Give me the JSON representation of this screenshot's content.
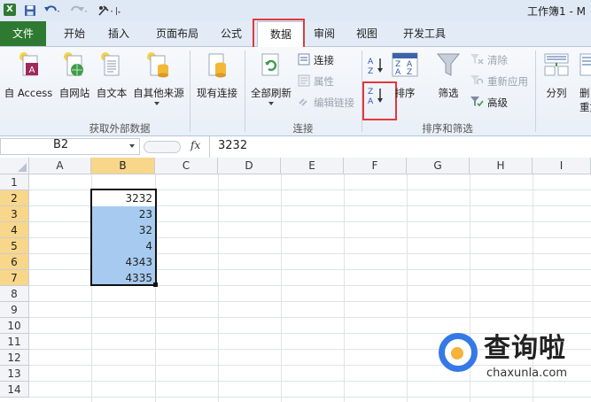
{
  "window": {
    "title": "工作簿1 - M"
  },
  "quick_access": {
    "save_icon": "save-icon",
    "undo_icon": "undo-icon",
    "redo_icon": "redo-icon",
    "custom_icon": "customize-icon"
  },
  "tabs": [
    "文件",
    "开始",
    "插入",
    "页面布局",
    "公式",
    "数据",
    "审阅",
    "视图",
    "开发工具"
  ],
  "active_tab": "数据",
  "ribbon": {
    "get_external": {
      "buttons": [
        "自 Access",
        "自网站",
        "自文本",
        "自其他来源",
        "现有连接"
      ],
      "label": "获取外部数据"
    },
    "connections": {
      "refresh_all": "全部刷新",
      "items": [
        "连接",
        "属性",
        "编辑链接"
      ],
      "label": "连接"
    },
    "sort_filter": {
      "sort": "排序",
      "filter": "筛选",
      "items": [
        "清除",
        "重新应用",
        "高级"
      ],
      "label": "排序和筛选"
    },
    "data_tools": {
      "split": "分列",
      "delete_partial": "删",
      "dup_partial": "重复"
    }
  },
  "formula_bar": {
    "name_box": "B2",
    "fx": "fx",
    "value": "3232"
  },
  "columns": [
    "A",
    "B",
    "C",
    "D",
    "E",
    "F",
    "G",
    "H",
    "I"
  ],
  "rows": [
    "1",
    "2",
    "3",
    "4",
    "5",
    "6",
    "7",
    "8",
    "9",
    "10",
    "11",
    "12",
    "13",
    "14"
  ],
  "cells_B": [
    "3232",
    "23",
    "32",
    "4",
    "4343",
    "4335"
  ],
  "watermark": {
    "title": "查询啦",
    "url": "chaxunla.com"
  },
  "colors": {
    "file_tab": "#2f7a32",
    "highlight": "#e2383f",
    "selection_fill": "#a7cbf0",
    "header_selected": "#f8d68a"
  }
}
